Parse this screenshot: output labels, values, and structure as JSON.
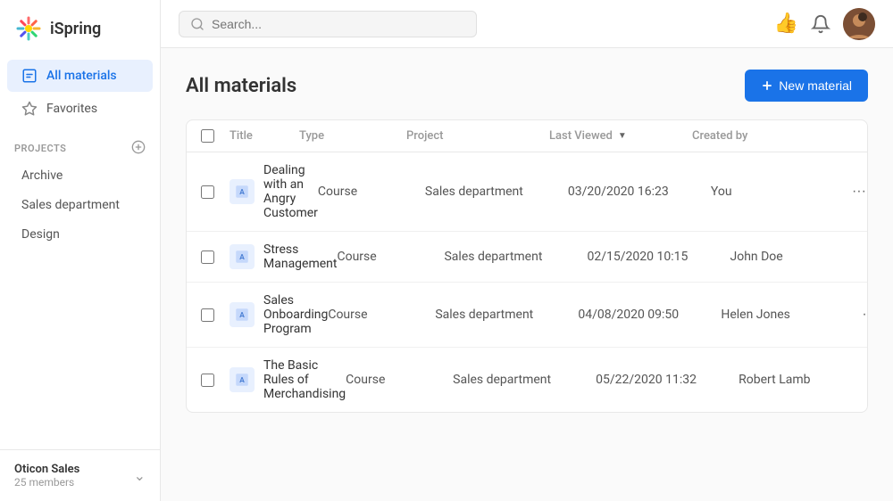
{
  "logo": {
    "text": "iSpring"
  },
  "sidebar": {
    "nav": [
      {
        "id": "all-materials",
        "label": "All materials",
        "active": true,
        "icon": "file-icon"
      },
      {
        "id": "favorites",
        "label": "Favorites",
        "active": false,
        "icon": "star-icon"
      }
    ],
    "projects_label": "PROJECTS",
    "projects": [
      {
        "id": "archive",
        "label": "Archive"
      },
      {
        "id": "sales-department",
        "label": "Sales department"
      },
      {
        "id": "design",
        "label": "Design"
      }
    ],
    "footer": {
      "org_name": "Oticon Sales",
      "org_members": "25 members"
    }
  },
  "topbar": {
    "search_placeholder": "Search...",
    "search_value": ""
  },
  "content": {
    "page_title": "All materials",
    "new_material_label": "+ New material",
    "table": {
      "headers": [
        {
          "id": "check",
          "label": ""
        },
        {
          "id": "title",
          "label": "Title"
        },
        {
          "id": "type",
          "label": "Type"
        },
        {
          "id": "project",
          "label": "Project"
        },
        {
          "id": "last_viewed",
          "label": "Last Viewed",
          "sortable": true
        },
        {
          "id": "created_by",
          "label": "Created by"
        },
        {
          "id": "actions",
          "label": ""
        }
      ],
      "rows": [
        {
          "id": 1,
          "title": "Dealing with an Angry Customer",
          "type": "Course",
          "project": "Sales department",
          "last_viewed": "03/20/2020 16:23",
          "created_by": "You"
        },
        {
          "id": 2,
          "title": "Stress Management",
          "type": "Course",
          "project": "Sales department",
          "last_viewed": "02/15/2020 10:15",
          "created_by": "John Doe"
        },
        {
          "id": 3,
          "title": "Sales Onboarding Program",
          "type": "Course",
          "project": "Sales department",
          "last_viewed": "04/08/2020 09:50",
          "created_by": "Helen Jones"
        },
        {
          "id": 4,
          "title": "The Basic Rules of Merchandising",
          "type": "Course",
          "project": "Sales department",
          "last_viewed": "05/22/2020 11:32",
          "created_by": "Robert Lamb"
        }
      ]
    }
  }
}
